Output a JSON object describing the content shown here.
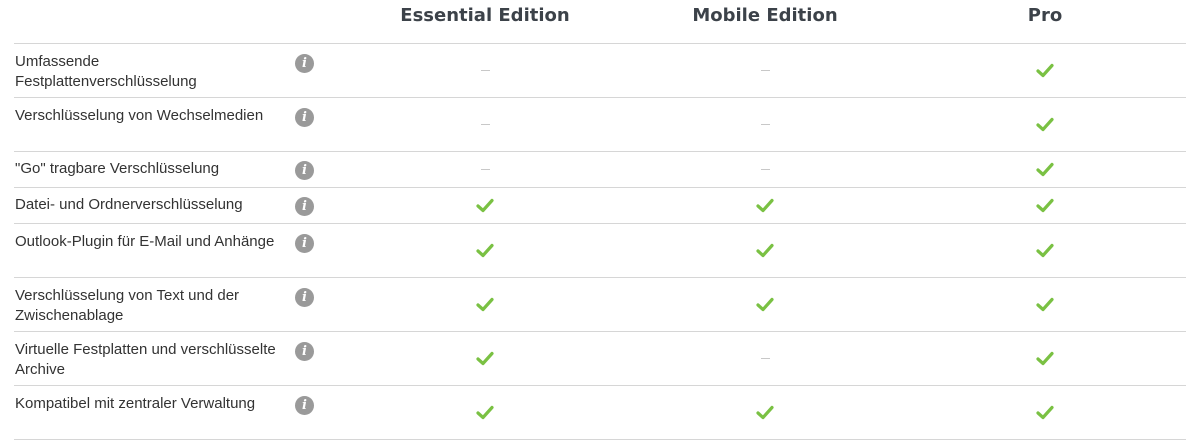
{
  "columns": {
    "essential": "Essential Edition",
    "mobile": "Mobile Edition",
    "pro": "Pro"
  },
  "info_glyph": "i",
  "colors": {
    "check": "#7ac143",
    "dash": "#c8c8c8",
    "info_bg": "#9a9a9a",
    "divider": "#d6d6d6"
  },
  "rows": [
    {
      "feature": "Umfassende Festplattenverschlüsselung",
      "essential": false,
      "mobile": false,
      "pro": true
    },
    {
      "feature": "Verschlüsselung von Wechselmedien",
      "essential": false,
      "mobile": false,
      "pro": true
    },
    {
      "feature": "\"Go\" tragbare Verschlüsselung",
      "essential": false,
      "mobile": false,
      "pro": true
    },
    {
      "feature": "Datei- und Ordnerverschlüsselung",
      "essential": true,
      "mobile": true,
      "pro": true
    },
    {
      "feature": "Outlook-Plugin für E-Mail und Anhänge",
      "essential": true,
      "mobile": true,
      "pro": true
    },
    {
      "feature": "Verschlüsselung von Text und der Zwischenablage",
      "essential": true,
      "mobile": true,
      "pro": true
    },
    {
      "feature": "Virtuelle Festplatten und verschlüsselte Archive",
      "essential": true,
      "mobile": false,
      "pro": true
    },
    {
      "feature": "Kompatibel mit zentraler Verwaltung",
      "essential": true,
      "mobile": true,
      "pro": true
    }
  ]
}
